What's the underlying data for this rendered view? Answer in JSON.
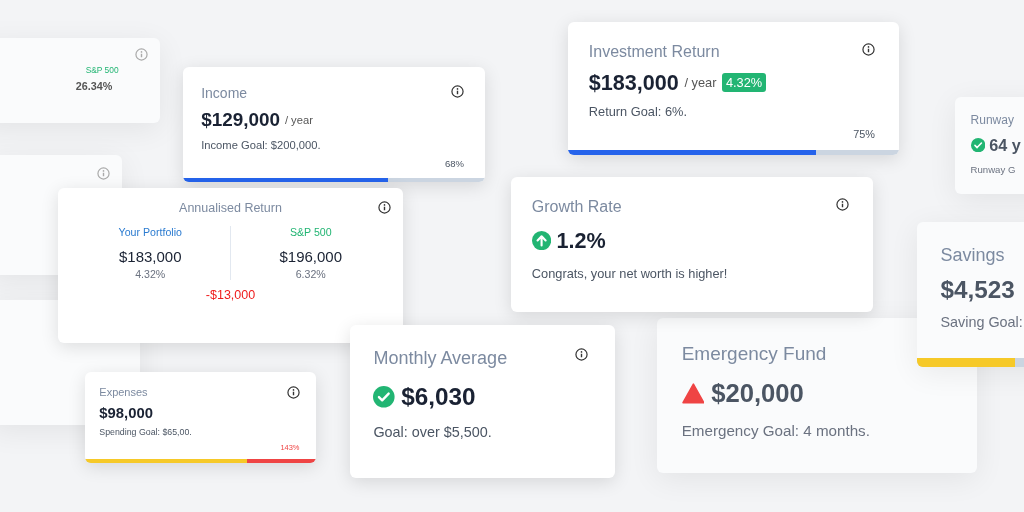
{
  "cards": [
    {
      "kind": "stat",
      "blurred": true,
      "info_icon": true,
      "label": "S&P 500",
      "value": "26.34%"
    },
    {
      "kind": "blank",
      "blurred": true,
      "info_icon": true
    },
    {
      "kind": "blank",
      "blurred": true,
      "info_icon": false
    },
    {
      "kind": "met",
      "blurred": true,
      "info_icon": false,
      "title": "Runway",
      "value": "64 y",
      "goal": "Runway G"
    },
    {
      "kind": "alert",
      "blurred": true,
      "info_icon": false,
      "title": "Emergency Fund",
      "value": "$20,000",
      "goal": "Emergency Goal: 4 months."
    },
    {
      "kind": "progress",
      "blurred": true,
      "info_icon": false,
      "title": "Savings",
      "value": "$4,523",
      "goal": "Saving Goal:",
      "segments": [
        {
          "color": "#f6c928",
          "level": 0.7
        }
      ]
    },
    {
      "kind": "progress",
      "blurred": false,
      "info_icon": true,
      "title": "Income",
      "value": "$129,000",
      "unit": "/ year",
      "goal": "Income Goal: $200,000.",
      "percent": "68%",
      "segments": [
        {
          "color": "#2563eb",
          "level": 0.68
        }
      ]
    },
    {
      "kind": "progress",
      "blurred": false,
      "info_icon": true,
      "title": "Investment Return",
      "value": "$183,000",
      "unit": "/ year",
      "badge": "4.32%",
      "goal": "Return Goal: 6%.",
      "percent": "75%",
      "segments": [
        {
          "color": "#2563eb",
          "level": 0.75
        }
      ]
    },
    {
      "kind": "comparison",
      "blurred": false,
      "info_icon": true,
      "title": "Annualised Return",
      "columns": [
        {
          "label": "Your Portfolio",
          "value": "$183,000",
          "sub": "4.32%"
        },
        {
          "label": "S&P 500",
          "value": "$196,000",
          "sub": "6.32%"
        }
      ],
      "difference": "-$13,000"
    },
    {
      "kind": "growth",
      "blurred": false,
      "info_icon": true,
      "title": "Growth Rate",
      "value": "1.2%",
      "goal": "Congrats, your net worth is higher!"
    },
    {
      "kind": "progress",
      "blurred": false,
      "info_icon": true,
      "title": "Expenses",
      "value": "$98,000",
      "goal": "Spending Goal: $65,00.",
      "percent": "143%",
      "segments": [
        {
          "color": "#f6c928",
          "level": 0.7
        },
        {
          "color": "#ef4444",
          "level": 0.3
        }
      ]
    },
    {
      "kind": "met",
      "blurred": false,
      "info_icon": true,
      "title": "Monthly Average",
      "value": "$6,030",
      "goal": "Goal: over $5,500."
    }
  ]
}
